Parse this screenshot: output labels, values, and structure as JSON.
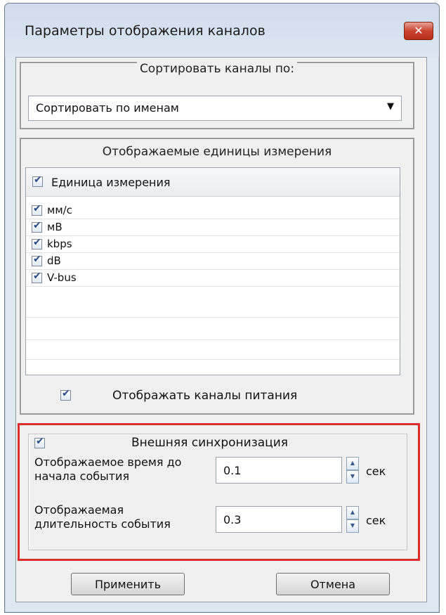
{
  "window": {
    "title": "Параметры отображения каналов",
    "close_glyph": "✕"
  },
  "sort": {
    "legend": "Сортировать каналы по:",
    "selected": "Сортировать по именам",
    "arrow": "▼"
  },
  "units": {
    "legend": "Отображаемые единицы измерения",
    "header": "Единица измерения",
    "items": [
      {
        "label": "мм/с",
        "checked": true
      },
      {
        "label": "мВ",
        "checked": true
      },
      {
        "label": "kbps",
        "checked": true
      },
      {
        "label": "dB",
        "checked": true
      },
      {
        "label": "V-bus",
        "checked": true
      }
    ],
    "power_label": "Отображать каналы питания"
  },
  "sync": {
    "label": "Внешняя синхронизация",
    "before_label_1": "Отображаемое время до",
    "before_label_2": "начала события",
    "before_value": "0.1",
    "duration_label_1": "Отображаемая",
    "duration_label_2": "длительность события",
    "duration_value": "0.3",
    "unit": "сек",
    "highlight_color": "#dc2d2d"
  },
  "buttons": {
    "apply": "Применить",
    "cancel": "Отмена"
  }
}
